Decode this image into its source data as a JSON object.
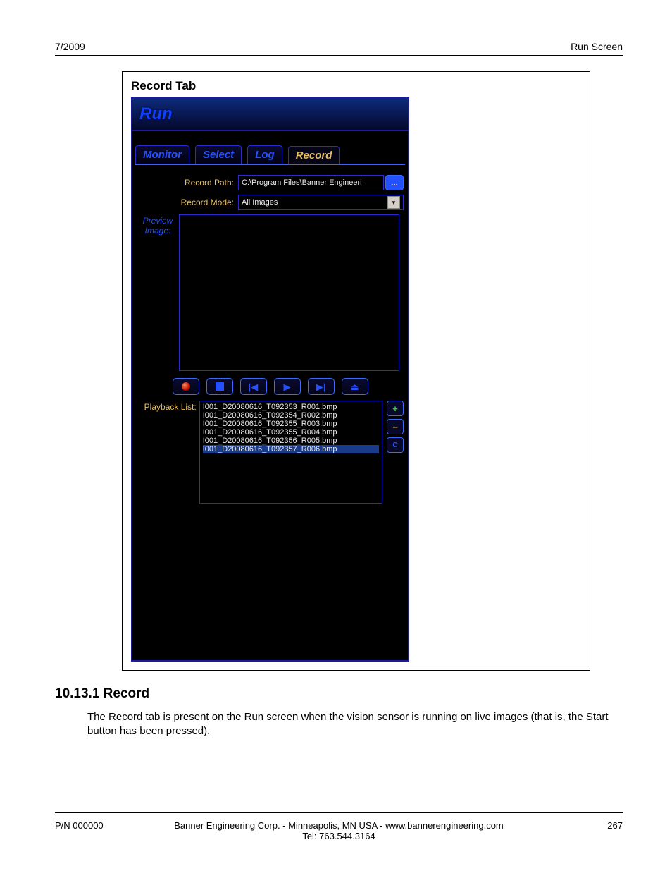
{
  "header": {
    "left": "7/2009",
    "right": "Run Screen"
  },
  "figure": {
    "title": "Record Tab",
    "app_title": "Run",
    "tabs": [
      {
        "label": "Monitor",
        "active": false
      },
      {
        "label": "Select",
        "active": false
      },
      {
        "label": "Log",
        "active": false
      },
      {
        "label": "Record",
        "active": true
      }
    ],
    "record_path_label": "Record Path:",
    "record_path_value": "C:\\Program Files\\Banner Engineeri",
    "browse_label": "...",
    "record_mode_label": "Record Mode:",
    "record_mode_value": "All Images",
    "preview_label_line1": "Preview",
    "preview_label_line2": "Image:",
    "playback_label": "Playback List:",
    "playback_items": [
      "I001_D20080616_T092353_R001.bmp",
      "I001_D20080616_T092354_R002.bmp",
      "I001_D20080616_T092355_R003.bmp",
      "I001_D20080616_T092355_R004.bmp",
      "I001_D20080616_T092356_R005.bmp",
      "I001_D20080616_T092357_R006.bmp"
    ],
    "playback_selected_index": 5,
    "side_plus": "+",
    "side_minus": "−",
    "side_clear": "C"
  },
  "section": {
    "heading": "10.13.1 Record",
    "body": "The Record tab is present on the Run screen when the vision sensor is running on live images (that is, the Start button has been pressed)."
  },
  "footer": {
    "left": "P/N 000000",
    "center_line1": "Banner Engineering Corp. - Minneapolis, MN USA - www.bannerengineering.com",
    "center_line2": "Tel: 763.544.3164",
    "right": "267"
  }
}
